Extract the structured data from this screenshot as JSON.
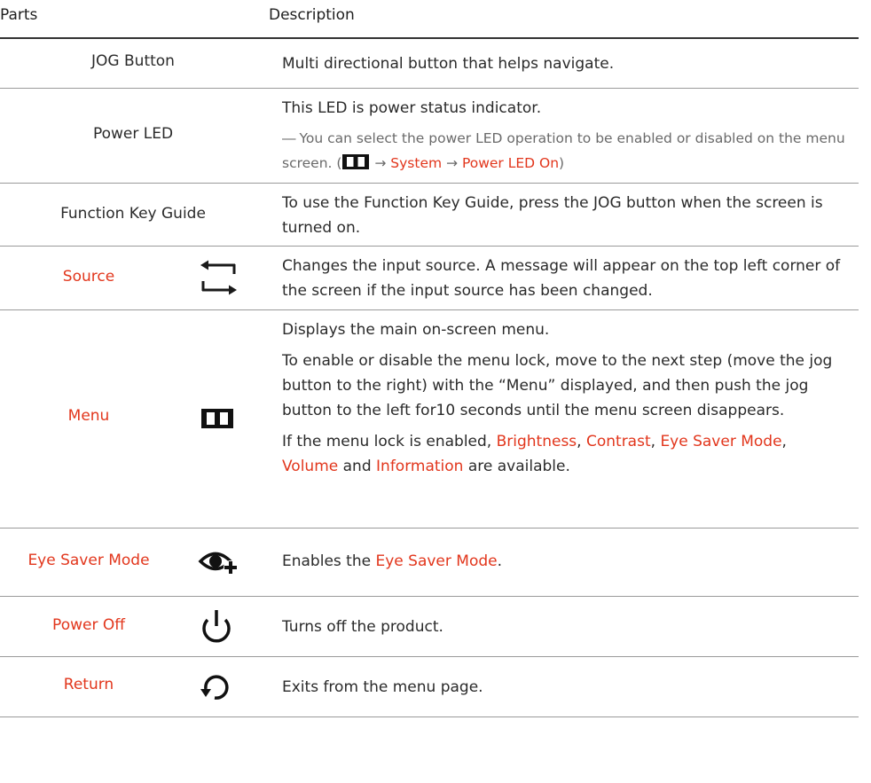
{
  "header": {
    "parts": "Parts",
    "description": "Description"
  },
  "rows": {
    "jog": {
      "part": "JOG Button",
      "desc": "Multi directional button that helps navigate."
    },
    "power_led": {
      "part": "Power LED",
      "desc": "This LED is power status indicator.",
      "note_dash": "―",
      "note_text": "You can select the power LED operation to be enabled or disabled on the menu screen. (",
      "arrow1": " → ",
      "system": "System",
      "arrow2": " → ",
      "power_led_on": "Power LED On",
      "close_paren": ")"
    },
    "function_key": {
      "part": "Function Key Guide",
      "desc": "To use the Function Key Guide, press the JOG button when the screen is turned on."
    },
    "source": {
      "part": "Source",
      "icon": "source-arrows-icon",
      "desc": "Changes the input source. A message will appear on the top left corner of the screen if the input source has been changed."
    },
    "menu": {
      "part": "Menu",
      "icon": "menu-bars-icon",
      "desc1": "Displays the main on-screen menu.",
      "desc2": "To enable or disable the menu lock, move to the next step (move the jog button to the right) with the “Menu” displayed, and then push the jog button to the left for10 seconds until the menu screen disappears.",
      "desc3_pre": "If the menu lock is enabled, ",
      "brightness": "Brightness",
      "comma1": ", ",
      "contrast": "Contrast",
      "comma2": ", ",
      "eye_saver": "Eye Saver Mode",
      "comma3": ",",
      "volume": "Volume",
      "and": " and ",
      "information": "Information",
      "desc3_post": " are available."
    },
    "eye_saver": {
      "part": "Eye Saver Mode",
      "icon": "eye-saver-icon",
      "desc_pre": "Enables the ",
      "desc_hl": "Eye Saver Mode",
      "desc_post": "."
    },
    "power_off": {
      "part": "Power Off",
      "icon": "power-icon",
      "desc": "Turns off the product."
    },
    "return": {
      "part": "Return",
      "icon": "return-arrow-icon",
      "desc": "Exits from the menu page."
    }
  },
  "colors": {
    "accent": "#e2361c",
    "text": "#2a2a2a",
    "note": "#6a6a6a"
  }
}
